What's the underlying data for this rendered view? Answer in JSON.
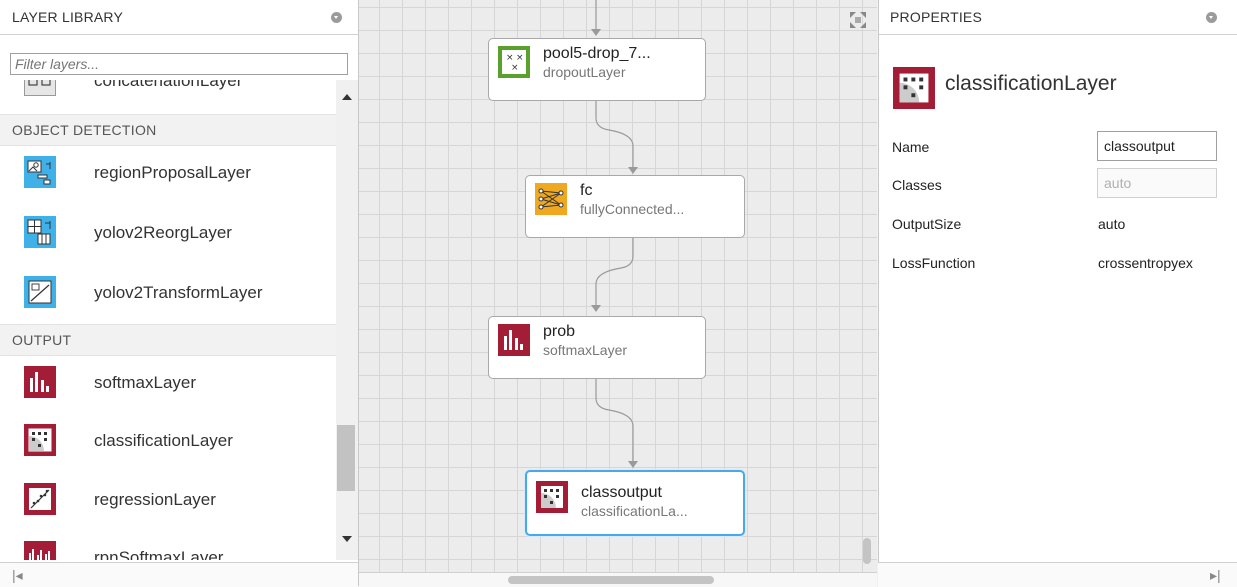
{
  "layer_library": {
    "title": "LAYER LIBRARY",
    "filter_placeholder": "Filter layers...",
    "partial_top_item": "concatenationLayer",
    "categories": {
      "object_detection": "OBJECT DETECTION",
      "output": "OUTPUT"
    },
    "items": [
      {
        "label": "regionProposalLayer",
        "icon": "region-proposal-icon"
      },
      {
        "label": "yolov2ReorgLayer",
        "icon": "yolov2-reorg-icon"
      },
      {
        "label": "yolov2TransformLayer",
        "icon": "yolov2-transform-icon"
      },
      {
        "label": "softmaxLayer",
        "icon": "softmax-icon"
      },
      {
        "label": "classificationLayer",
        "icon": "classification-icon"
      },
      {
        "label": "regressionLayer",
        "icon": "regression-icon"
      },
      {
        "label": "rpnSoftmaxLayer",
        "icon": "rpn-softmax-icon"
      }
    ],
    "footer_left": "|◂"
  },
  "canvas": {
    "nodes": [
      {
        "name": "pool5-drop_7...",
        "type": "dropoutLayer",
        "icon": "dropout-icon",
        "color": "#5aa02c"
      },
      {
        "name": "fc",
        "type": "fullyConnected...",
        "icon": "fully-connected-icon",
        "color": "#efa81f"
      },
      {
        "name": "prob",
        "type": "softmaxLayer",
        "icon": "softmax-icon",
        "color": "#a31d36"
      },
      {
        "name": "classoutput",
        "type": "classificationLa...",
        "icon": "classification-icon",
        "color": "#a31d36",
        "selected": true
      }
    ]
  },
  "properties": {
    "title": "PROPERTIES",
    "layer_type": "classificationLayer",
    "rows": [
      {
        "key": "Name",
        "value": "classoutput",
        "kind": "input"
      },
      {
        "key": "Classes",
        "value": "auto",
        "kind": "disabled-input"
      },
      {
        "key": "OutputSize",
        "value": "auto",
        "kind": "text"
      },
      {
        "key": "LossFunction",
        "value": "crossentropyex",
        "kind": "text"
      }
    ],
    "footer_right": "▸|"
  },
  "colors": {
    "accent_blue": "#47a9ea",
    "output_red": "#a31d36",
    "detection_blue": "#3fb0e8",
    "dropout_green": "#5aa02c",
    "fc_orange": "#efa81f"
  }
}
